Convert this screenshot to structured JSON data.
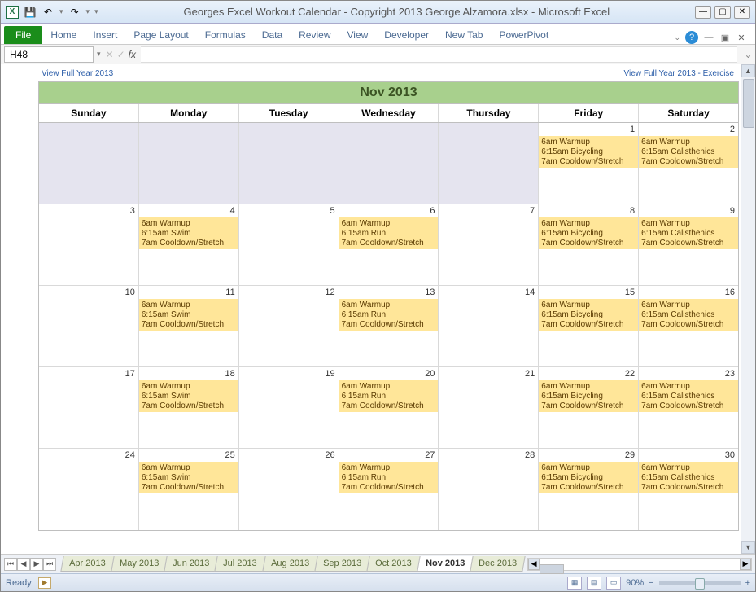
{
  "window": {
    "title": "Georges Excel Workout Calendar - Copyright 2013 George Alzamora.xlsx - Microsoft Excel"
  },
  "ribbon": {
    "file": "File",
    "tabs": [
      "Home",
      "Insert",
      "Page Layout",
      "Formulas",
      "Data",
      "Review",
      "View",
      "Developer",
      "New Tab",
      "PowerPivot"
    ]
  },
  "namebox": "H48",
  "fx": "fx",
  "links": {
    "left": "View Full Year 2013",
    "right": "View Full Year 2013 - Exercise"
  },
  "calendar": {
    "title": "Nov 2013",
    "days": [
      "Sunday",
      "Monday",
      "Tuesday",
      "Wednesday",
      "Thursday",
      "Friday",
      "Saturday"
    ],
    "weeks": [
      [
        {
          "blank": true
        },
        {
          "blank": true
        },
        {
          "blank": true
        },
        {
          "blank": true
        },
        {
          "blank": true
        },
        {
          "n": "1",
          "ev": [
            "6am Warmup",
            "6:15am Bicycling",
            "7am Cooldown/Stretch"
          ]
        },
        {
          "n": "2",
          "ev": [
            "6am Warmup",
            "6:15am Calisthenics",
            "7am Cooldown/Stretch"
          ]
        }
      ],
      [
        {
          "n": "3"
        },
        {
          "n": "4",
          "ev": [
            "6am Warmup",
            "6:15am Swim",
            "7am Cooldown/Stretch"
          ]
        },
        {
          "n": "5"
        },
        {
          "n": "6",
          "ev": [
            "6am Warmup",
            "6:15am Run",
            "7am Cooldown/Stretch"
          ]
        },
        {
          "n": "7"
        },
        {
          "n": "8",
          "ev": [
            "6am Warmup",
            "6:15am Bicycling",
            "7am Cooldown/Stretch"
          ]
        },
        {
          "n": "9",
          "ev": [
            "6am Warmup",
            "6:15am Calisthenics",
            "7am Cooldown/Stretch"
          ]
        }
      ],
      [
        {
          "n": "10"
        },
        {
          "n": "11",
          "ev": [
            "6am Warmup",
            "6:15am Swim",
            "7am Cooldown/Stretch"
          ]
        },
        {
          "n": "12"
        },
        {
          "n": "13",
          "ev": [
            "6am Warmup",
            "6:15am Run",
            "7am Cooldown/Stretch"
          ]
        },
        {
          "n": "14"
        },
        {
          "n": "15",
          "ev": [
            "6am Warmup",
            "6:15am Bicycling",
            "7am Cooldown/Stretch"
          ]
        },
        {
          "n": "16",
          "ev": [
            "6am Warmup",
            "6:15am Calisthenics",
            "7am Cooldown/Stretch"
          ]
        }
      ],
      [
        {
          "n": "17"
        },
        {
          "n": "18",
          "ev": [
            "6am Warmup",
            "6:15am Swim",
            "7am Cooldown/Stretch"
          ]
        },
        {
          "n": "19"
        },
        {
          "n": "20",
          "ev": [
            "6am Warmup",
            "6:15am Run",
            "7am Cooldown/Stretch"
          ]
        },
        {
          "n": "21"
        },
        {
          "n": "22",
          "ev": [
            "6am Warmup",
            "6:15am Bicycling",
            "7am Cooldown/Stretch"
          ]
        },
        {
          "n": "23",
          "ev": [
            "6am Warmup",
            "6:15am Calisthenics",
            "7am Cooldown/Stretch"
          ]
        }
      ],
      [
        {
          "n": "24"
        },
        {
          "n": "25",
          "ev": [
            "6am Warmup",
            "6:15am Swim",
            "7am Cooldown/Stretch"
          ]
        },
        {
          "n": "26"
        },
        {
          "n": "27",
          "ev": [
            "6am Warmup",
            "6:15am Run",
            "7am Cooldown/Stretch"
          ]
        },
        {
          "n": "28"
        },
        {
          "n": "29",
          "ev": [
            "6am Warmup",
            "6:15am Bicycling",
            "7am Cooldown/Stretch"
          ]
        },
        {
          "n": "30",
          "ev": [
            "6am Warmup",
            "6:15am Calisthenics",
            "7am Cooldown/Stretch"
          ]
        }
      ]
    ]
  },
  "sheets": [
    "Apr 2013",
    "May 2013",
    "Jun 2013",
    "Jul 2013",
    "Aug 2013",
    "Sep 2013",
    "Oct 2013",
    "Nov 2013",
    "Dec 2013"
  ],
  "active_sheet": "Nov 2013",
  "status": {
    "ready": "Ready",
    "zoom": "90%"
  }
}
